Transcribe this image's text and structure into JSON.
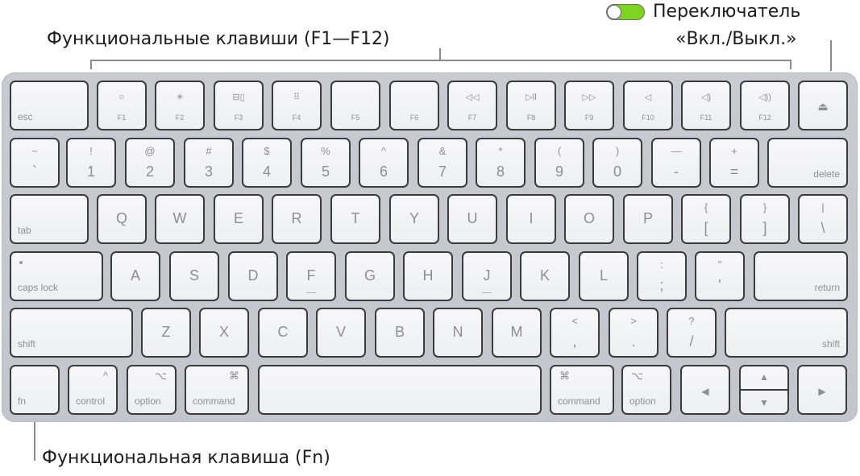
{
  "callouts": {
    "function_keys": "Функциональные клавиши (F1—F12)",
    "power_switch_line1": "Переключатель",
    "power_switch_line2": "«Вкл./Выкл.»",
    "fn_key": "Функциональная клавиша (Fn)"
  },
  "colors": {
    "toggle_on": "#7ed321",
    "keyboard_body": "#c6c8ce",
    "key_face": "#f4f4f6",
    "key_border": "#3b3b3d",
    "label_text": "#1d1d1f"
  },
  "keyboard": {
    "row_function": [
      {
        "label": "esc",
        "icon": ""
      },
      {
        "label": "F1",
        "icon": "brightness-down-icon",
        "glyph": "☼"
      },
      {
        "label": "F2",
        "icon": "brightness-up-icon",
        "glyph": "☀"
      },
      {
        "label": "F3",
        "icon": "mission-control-icon",
        "glyph": "⊟▯"
      },
      {
        "label": "F4",
        "icon": "launchpad-icon",
        "glyph": "⠿"
      },
      {
        "label": "F5",
        "icon": ""
      },
      {
        "label": "F6",
        "icon": ""
      },
      {
        "label": "F7",
        "icon": "rewind-icon",
        "glyph": "◁◁"
      },
      {
        "label": "F8",
        "icon": "play-pause-icon",
        "glyph": "▷ll"
      },
      {
        "label": "F9",
        "icon": "fast-forward-icon",
        "glyph": "▷▷"
      },
      {
        "label": "F10",
        "icon": "mute-icon",
        "glyph": "◁"
      },
      {
        "label": "F11",
        "icon": "volume-down-icon",
        "glyph": "◁)"
      },
      {
        "label": "F12",
        "icon": "volume-up-icon",
        "glyph": "◁))"
      },
      {
        "label": "",
        "icon": "eject-icon",
        "glyph": "⏏"
      }
    ],
    "row_numbers": [
      {
        "top": "~",
        "bottom": "`"
      },
      {
        "top": "!",
        "bottom": "1"
      },
      {
        "top": "@",
        "bottom": "2"
      },
      {
        "top": "#",
        "bottom": "3"
      },
      {
        "top": "$",
        "bottom": "4"
      },
      {
        "top": "%",
        "bottom": "5"
      },
      {
        "top": "^",
        "bottom": "6"
      },
      {
        "top": "&",
        "bottom": "7"
      },
      {
        "top": "*",
        "bottom": "8"
      },
      {
        "top": "(",
        "bottom": "9"
      },
      {
        "top": ")",
        "bottom": "0"
      },
      {
        "top": "—",
        "bottom": "-"
      },
      {
        "top": "+",
        "bottom": "="
      },
      {
        "label": "delete"
      }
    ],
    "row_qwerty": [
      {
        "label": "tab"
      },
      {
        "char": "Q"
      },
      {
        "char": "W"
      },
      {
        "char": "E"
      },
      {
        "char": "R"
      },
      {
        "char": "T"
      },
      {
        "char": "Y"
      },
      {
        "char": "U"
      },
      {
        "char": "I"
      },
      {
        "char": "O"
      },
      {
        "char": "P"
      },
      {
        "top": "{",
        "bottom": "["
      },
      {
        "top": "}",
        "bottom": "]"
      },
      {
        "top": "|",
        "bottom": "\\"
      }
    ],
    "row_home": [
      {
        "label": "caps lock"
      },
      {
        "char": "A"
      },
      {
        "char": "S"
      },
      {
        "char": "D"
      },
      {
        "char": "F"
      },
      {
        "char": "G"
      },
      {
        "char": "H"
      },
      {
        "char": "J"
      },
      {
        "char": "K"
      },
      {
        "char": "L"
      },
      {
        "top": ":",
        "bottom": ";"
      },
      {
        "top": "\"",
        "bottom": "'"
      },
      {
        "label": "return"
      }
    ],
    "row_shift": [
      {
        "label": "shift"
      },
      {
        "char": "Z"
      },
      {
        "char": "X"
      },
      {
        "char": "C"
      },
      {
        "char": "V"
      },
      {
        "char": "B"
      },
      {
        "char": "N"
      },
      {
        "char": "M"
      },
      {
        "top": "<",
        "bottom": ","
      },
      {
        "top": ">",
        "bottom": "."
      },
      {
        "top": "?",
        "bottom": "/"
      },
      {
        "label": "shift"
      }
    ],
    "row_bottom": [
      {
        "label": "fn"
      },
      {
        "label": "control",
        "symbol": "^"
      },
      {
        "label": "option",
        "symbol": "⌥"
      },
      {
        "label": "command",
        "symbol": "⌘"
      },
      {
        "label": ""
      },
      {
        "label": "command",
        "symbol": "⌘"
      },
      {
        "label": "option",
        "symbol": "⌥"
      },
      {
        "arrow": "◀"
      },
      {
        "arrow_up": "▲",
        "arrow_down": "▼"
      },
      {
        "arrow": "▶"
      }
    ]
  }
}
